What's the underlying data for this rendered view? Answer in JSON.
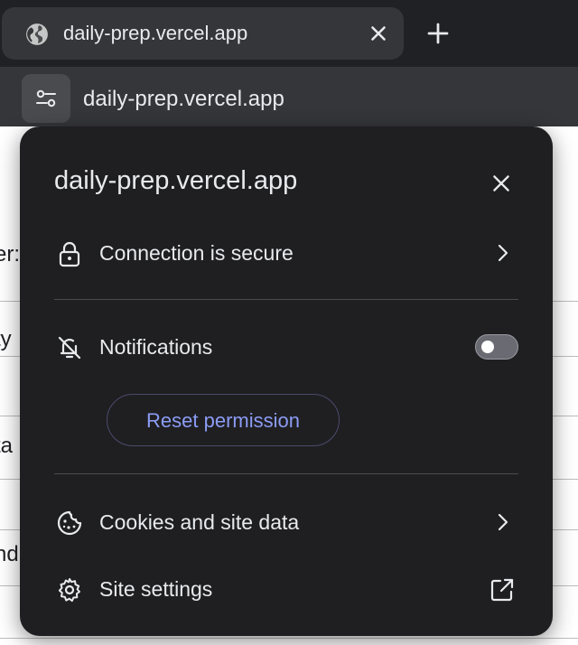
{
  "tab": {
    "title": "daily-prep.vercel.app",
    "icon": "globe-icon"
  },
  "address_bar": {
    "url": "daily-prep.vercel.app",
    "site_info_icon": "tune-icon"
  },
  "page_background": {
    "fragments": [
      "er:",
      "ty",
      "ta",
      "nd"
    ]
  },
  "popup": {
    "title": "daily-prep.vercel.app",
    "connection": {
      "label": "Connection is secure",
      "icon": "lock-icon"
    },
    "notifications": {
      "label": "Notifications",
      "icon": "bell-off-icon",
      "enabled": false
    },
    "reset_permission": "Reset permission",
    "cookies": {
      "label": "Cookies and site data",
      "icon": "cookie-icon"
    },
    "site_settings": {
      "label": "Site settings",
      "icon": "gear-icon"
    }
  },
  "colors": {
    "popup_bg": "#1f1f22",
    "accent": "#8c9cf4",
    "toolbar_bg": "#35363a"
  }
}
